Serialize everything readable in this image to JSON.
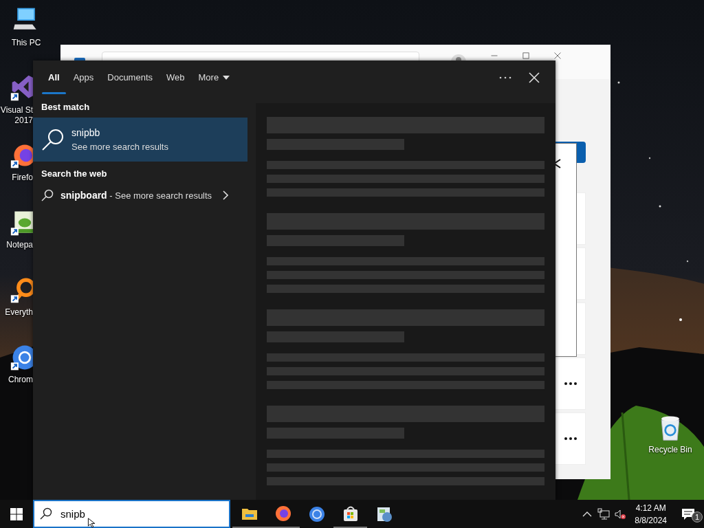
{
  "desktop_icons": [
    {
      "kind": "computer",
      "label": "This PC",
      "shortcut": false
    },
    {
      "kind": "visual-studio",
      "label": "Visual St\n2017",
      "shortcut": true
    },
    {
      "kind": "firefox",
      "label": "Firefo",
      "shortcut": true
    },
    {
      "kind": "notepad",
      "label": "Notepa",
      "shortcut": true
    },
    {
      "kind": "everything",
      "label": "Everyth",
      "shortcut": true
    },
    {
      "kind": "chromium",
      "label": "Chrom",
      "shortcut": true
    }
  ],
  "recycle_bin": {
    "label": "Recycle Bin"
  },
  "search_panel": {
    "tabs": [
      {
        "label": "All",
        "selected": true,
        "dropdown": false
      },
      {
        "label": "Apps",
        "selected": false,
        "dropdown": false
      },
      {
        "label": "Documents",
        "selected": false,
        "dropdown": false
      },
      {
        "label": "Web",
        "selected": false,
        "dropdown": false
      },
      {
        "label": "More",
        "selected": false,
        "dropdown": true
      }
    ],
    "sections": [
      {
        "heading": "Best match",
        "results": [
          {
            "kind": "best",
            "title": "snipbb",
            "subtitle": "See more search results",
            "selected": true
          }
        ]
      },
      {
        "heading": "Search the web",
        "results": [
          {
            "kind": "web",
            "title": "snipboard",
            "subtitle": "- See more search results",
            "selected": false
          }
        ]
      }
    ]
  },
  "taskbar": {
    "search": {
      "value": "snipb"
    },
    "apps": [
      {
        "kind": "explorer",
        "running": true
      },
      {
        "kind": "firefox",
        "running": true
      },
      {
        "kind": "chromium",
        "running": false
      },
      {
        "kind": "store",
        "running": true
      },
      {
        "kind": "control-panel",
        "running": false
      }
    ],
    "clock": {
      "time": "4:12 AM",
      "date": "8/8/2024"
    },
    "notifications": {
      "count": "1"
    }
  }
}
